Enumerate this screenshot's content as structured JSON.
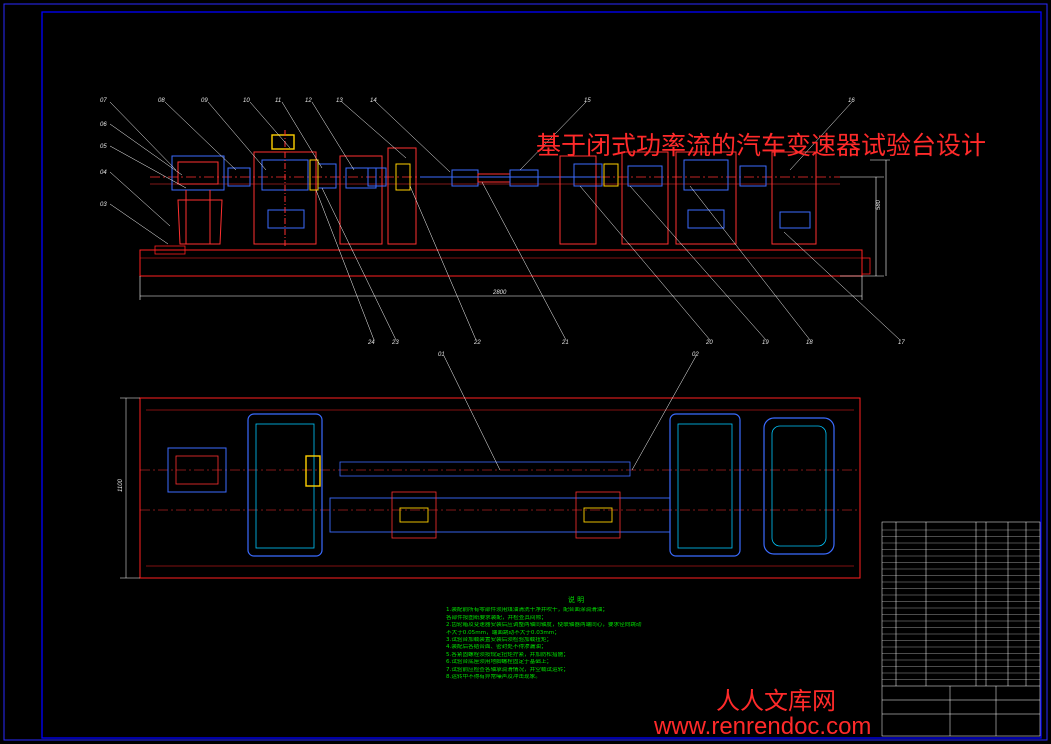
{
  "drawing": {
    "title": "基于闭式功率流的汽车变速器试验台设计",
    "part_labels_top": [
      "07",
      "08",
      "09",
      "10",
      "11",
      "12",
      "13",
      "14",
      "15",
      "16"
    ],
    "part_labels_left": [
      "06",
      "05",
      "04",
      "03"
    ],
    "part_labels_bottom": [
      "24",
      "23",
      "22",
      "21",
      "20",
      "19",
      "18",
      "17"
    ],
    "part_labels_plan": [
      "01",
      "02"
    ],
    "notes_title": "说 明",
    "notes": [
      "1.装配前所有零部件须用煤油清洗干净并吹干，配合面涂润滑油；",
      "  各部件按图纸要求装配，并检查其间隙；",
      "2.齿轮箱及变速器安装后应调整两轴同轴度，使联轴器两端同心，要求径向跳动",
      "  不大于0.05mm，端面跳动不大于0.03mm；",
      "3.试验台加载装置安装后须检验加载扭矩；",
      "4.装配后各结合面、密封处不得渗漏油；",
      "5.各紧固螺栓须按规定扭矩拧紧，并加防松措施；",
      "6.试验台底座须用地脚螺栓固定于基础上；",
      "7.试验前应检查各轴承润滑情况，并空载试运转；",
      "8.运转中不得有异常噪声及冲击现象。"
    ]
  },
  "watermark": {
    "cn": "人人文库网",
    "url": "www.renrendoc.com"
  },
  "colors": {
    "background": "#000000",
    "frame": "#0000ff",
    "outline": "#ff0000",
    "part_blue": "#3b6bff",
    "cyan": "#00c8ff",
    "leader": "#ffffff",
    "notes_green": "#00e000",
    "title_red": "#ff2a2a"
  }
}
